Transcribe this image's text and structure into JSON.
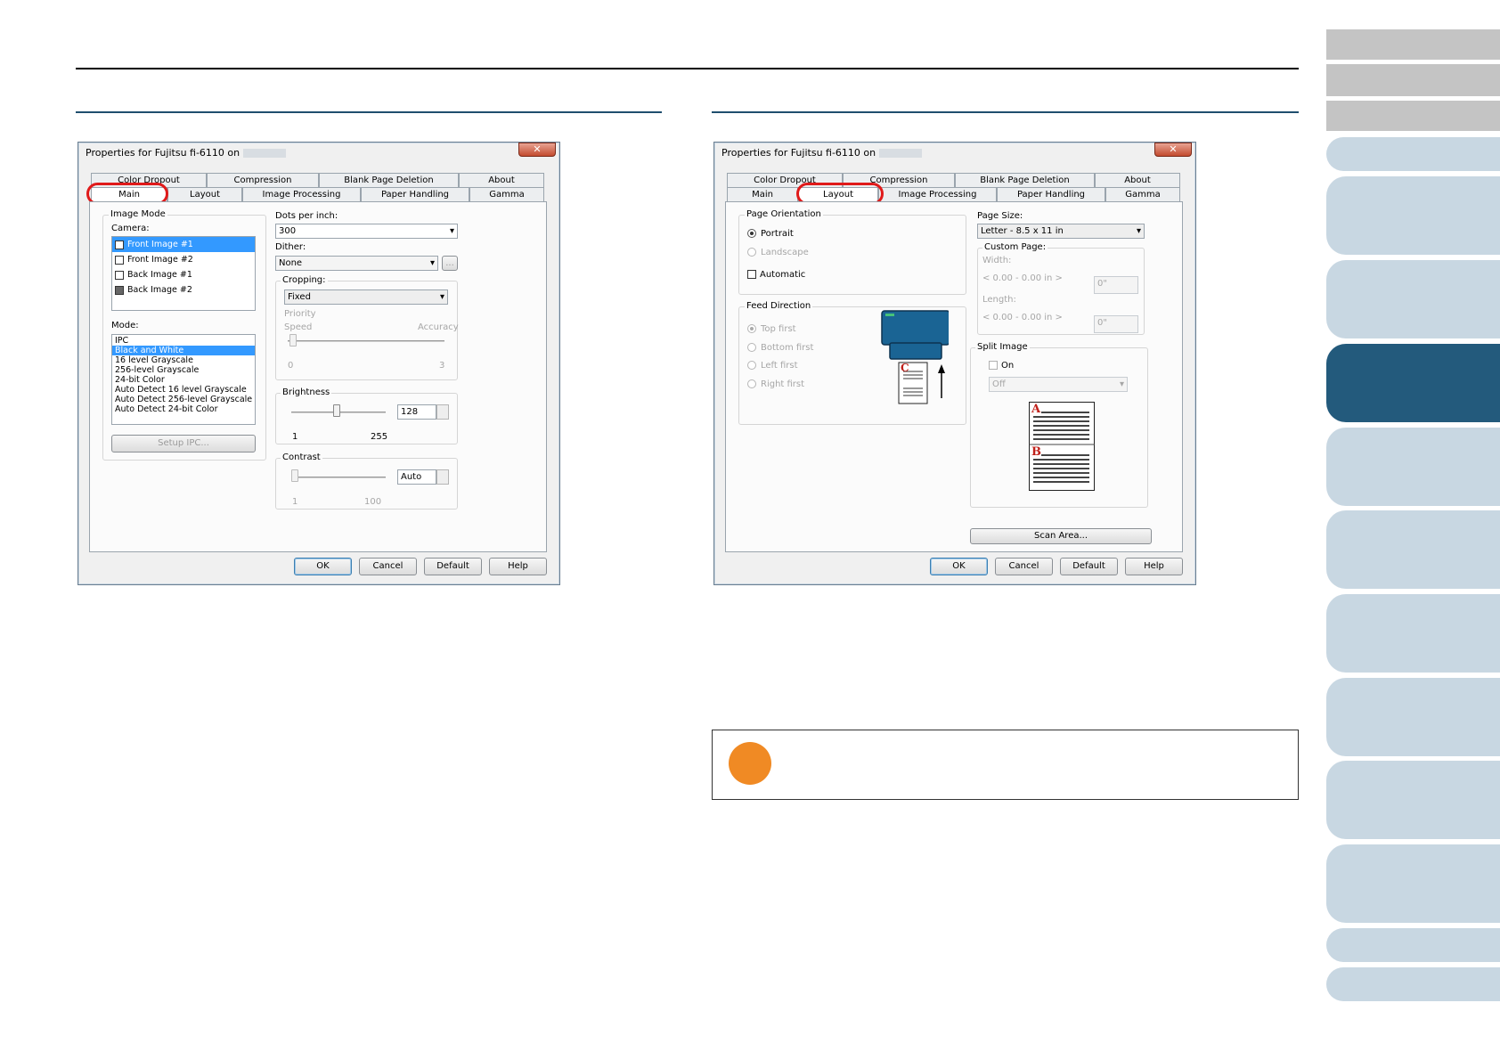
{
  "page": {
    "top_rule": "",
    "nav_tabs_count": 14
  },
  "left_dialog": {
    "title": "Properties for Fujitsu fi-6110 on",
    "close": "✕",
    "tabs_row1": [
      "Color Dropout",
      "Compression",
      "Blank Page Deletion",
      "About"
    ],
    "tabs_row2": [
      "Main",
      "Layout",
      "Image Processing",
      "Paper Handling",
      "Gamma"
    ],
    "image_mode_label": "Image Mode",
    "camera_label": "Camera:",
    "camera_items": [
      "Front Image #1",
      "Front Image #2",
      "Back Image #1",
      "Back Image #2"
    ],
    "mode_label": "Mode:",
    "mode_items": [
      "IPC",
      "Black and White",
      "16 level Grayscale",
      "256-level Grayscale",
      "24-bit Color",
      "Auto Detect 16 level Grayscale",
      "Auto Detect 256-level Grayscale",
      "Auto Detect 24-bit Color"
    ],
    "setup_ipc": "Setup IPC...",
    "dpi_label": "Dots per inch:",
    "dpi_value": "300",
    "dither_label": "Dither:",
    "dither_value": "None",
    "dither_more": "...",
    "cropping_label": "Cropping:",
    "cropping_value": "Fixed",
    "priority_label": "Priority",
    "speed_label": "Speed",
    "accuracy_label": "Accuracy",
    "priority_min": "0",
    "priority_max": "3",
    "brightness_label": "Brightness",
    "brightness_value": "128",
    "brightness_min": "1",
    "brightness_max": "255",
    "contrast_label": "Contrast",
    "contrast_value": "Auto",
    "contrast_min": "1",
    "contrast_max": "100",
    "buttons": {
      "ok": "OK",
      "cancel": "Cancel",
      "default": "Default",
      "help": "Help"
    }
  },
  "right_dialog": {
    "title": "Properties for Fujitsu fi-6110 on",
    "close": "✕",
    "tabs_row1": [
      "Color Dropout",
      "Compression",
      "Blank Page Deletion",
      "About"
    ],
    "tabs_row2": [
      "Main",
      "Layout",
      "Image Processing",
      "Paper Handling",
      "Gamma"
    ],
    "page_orientation_label": "Page Orientation",
    "portrait": "Portrait",
    "landscape": "Landscape",
    "automatic": "Automatic",
    "feed_direction_label": "Feed Direction",
    "top_first": "Top first",
    "bottom_first": "Bottom first",
    "left_first": "Left first",
    "right_first": "Right first",
    "page_size_label": "Page Size:",
    "page_size_value": "Letter - 8.5 x 11 in",
    "custom_page_label": "Custom Page:",
    "width_label": "Width:",
    "width_range": "< 0.00 - 0.00 in >",
    "width_value": "0\"",
    "length_label": "Length:",
    "length_range": "< 0.00 - 0.00 in >",
    "length_value": "0\"",
    "split_image_label": "Split Image",
    "split_on": "On",
    "split_value": "Off",
    "split_a": "A",
    "split_b": "B",
    "feed_c": "C",
    "scan_area": "Scan Area...",
    "buttons": {
      "ok": "OK",
      "cancel": "Cancel",
      "default": "Default",
      "help": "Help"
    }
  },
  "colors": {
    "accent": "#235a7c",
    "highlight": "#e01a1a",
    "note": "#f08a24",
    "nav": "#c8d7e2"
  }
}
